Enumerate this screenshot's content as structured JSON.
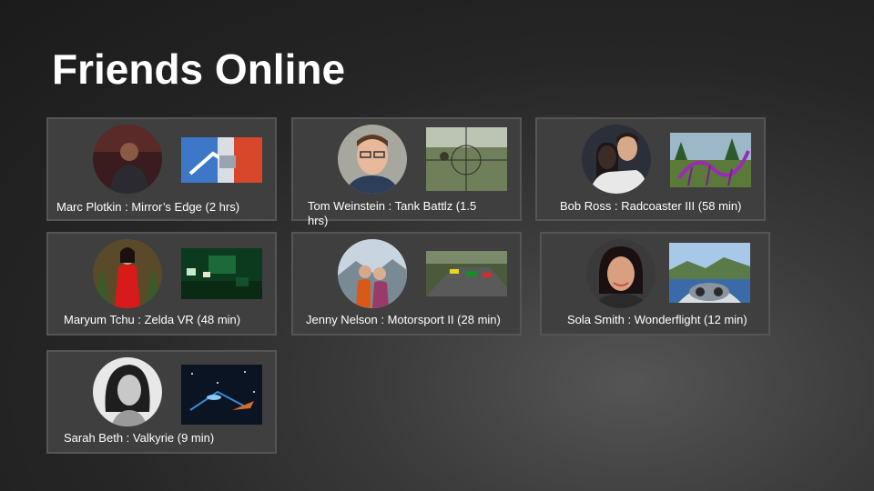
{
  "header": {
    "title": "Friends Online"
  },
  "friends": [
    {
      "name": "Marc Plotkin",
      "game": "Mirror's Edge",
      "time": "2 hrs",
      "label": "Marc Plotkin : Mirror’s Edge (2 hrs)"
    },
    {
      "name": "Tom Weinstein",
      "game": "Tank Battlz",
      "time": "1.5 hrs",
      "label": "Tom Weinstein : Tank Battlz (1.5 hrs)"
    },
    {
      "name": "Bob Ross",
      "game": "Radcoaster III",
      "time": "58 min",
      "label": "Bob Ross : Radcoaster III (58 min)"
    },
    {
      "name": "Maryum Tchu",
      "game": "Zelda VR",
      "time": "48 min",
      "label": "Maryum Tchu : Zelda VR (48 min)"
    },
    {
      "name": "Jenny Nelson",
      "game": "Motorsport II",
      "time": "28 min",
      "label": "Jenny Nelson : Motorsport II (28 min)"
    },
    {
      "name": "Sola Smith",
      "game": "Wonderflight",
      "time": "12 min",
      "label": "Sola Smith : Wonderflight (12 min)"
    },
    {
      "name": "Sarah Beth",
      "game": "Valkyrie",
      "time": "9 min",
      "label": "Sarah Beth : Valkyrie (9 min)"
    }
  ],
  "colors": {
    "background": "#262626",
    "card": "#3f3f3f",
    "card_border": "#555555",
    "text": "#ffffff"
  }
}
